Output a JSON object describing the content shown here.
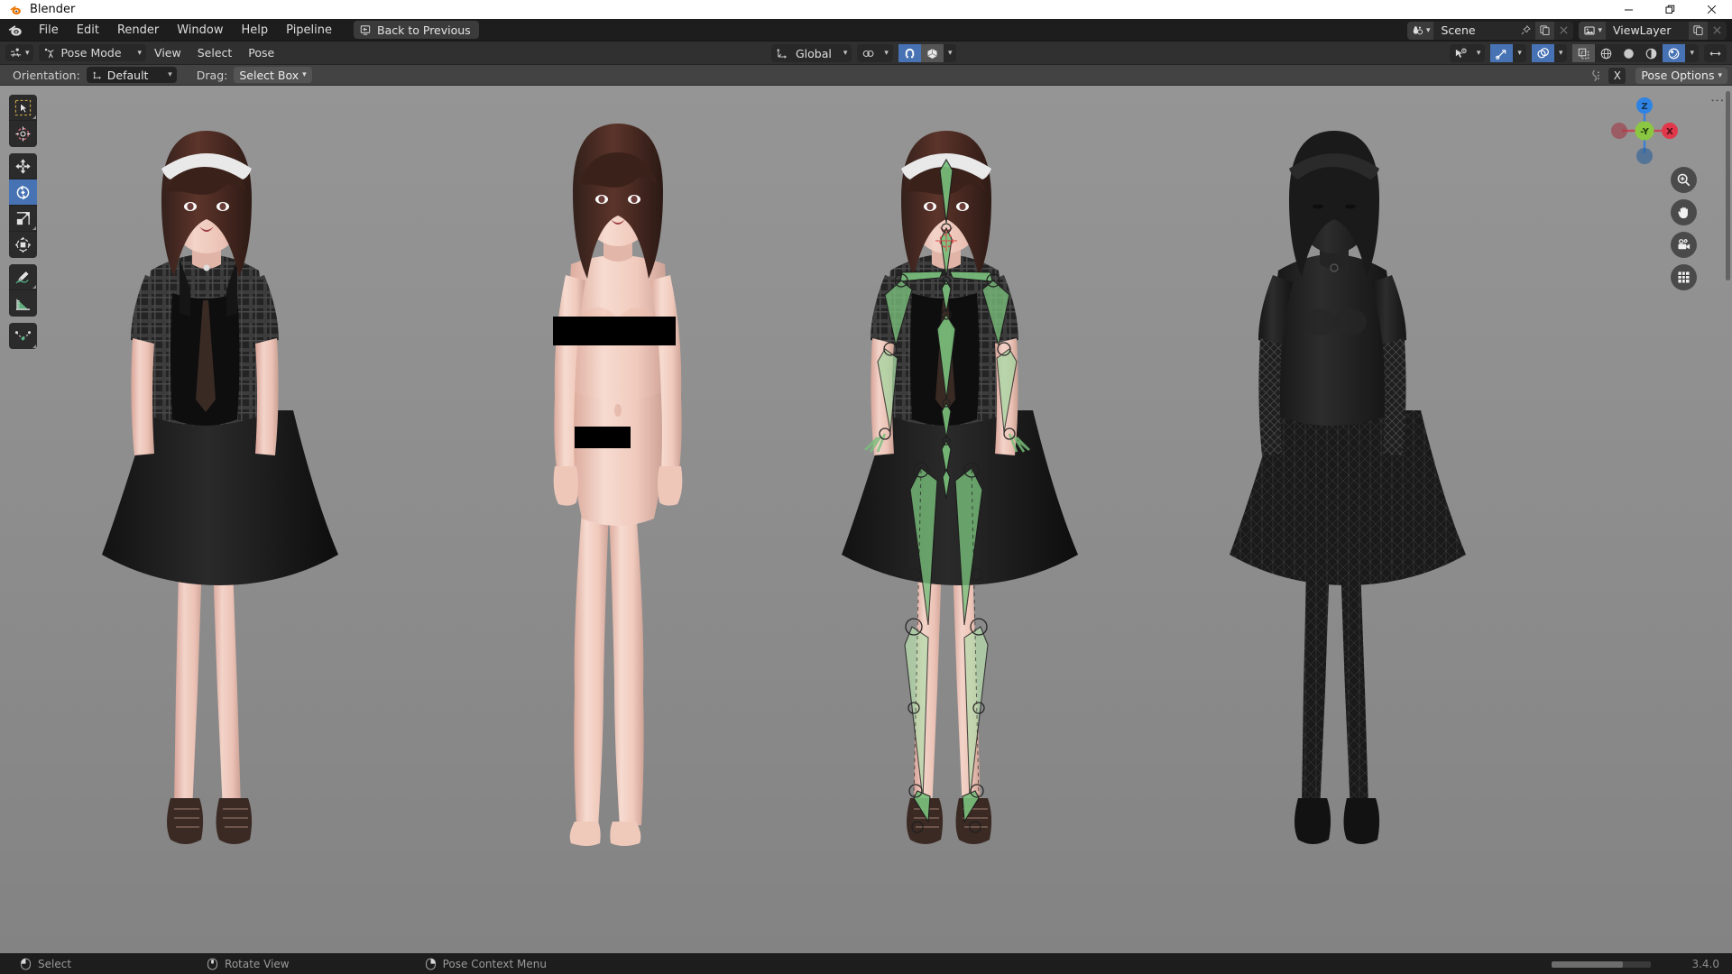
{
  "window": {
    "title": "Blender",
    "controls": {
      "minimize": "—",
      "restore": "❐",
      "close": "✕"
    }
  },
  "topbar": {
    "logo_icon": "blender-logo-icon",
    "menus": [
      {
        "label": "File",
        "name": "menu-file"
      },
      {
        "label": "Edit",
        "name": "menu-edit"
      },
      {
        "label": "Render",
        "name": "menu-render"
      },
      {
        "label": "Window",
        "name": "menu-window"
      },
      {
        "label": "Help",
        "name": "menu-help"
      },
      {
        "label": "Pipeline",
        "name": "menu-pipeline"
      }
    ],
    "back_button": {
      "label": "Back to Previous",
      "icon": "back-to-previous-icon"
    },
    "scene": {
      "icon": "scene-icon",
      "name": "Scene",
      "pin_icon": "pin-icon",
      "new_icon": "new-scene-icon",
      "close_icon": "close-icon"
    },
    "viewlayer": {
      "icon": "viewlayer-icon",
      "name": "ViewLayer",
      "new_icon": "new-viewlayer-icon",
      "close_icon": "close-icon"
    }
  },
  "viewport_header": {
    "editor_type_icon": "editor-type-3dview-icon",
    "mode": {
      "icon": "pose-mode-icon",
      "label": "Pose Mode",
      "chevron": "⌄"
    },
    "menus": [
      {
        "label": "View",
        "name": "viewport-menu-view"
      },
      {
        "label": "Select",
        "name": "viewport-menu-select"
      },
      {
        "label": "Pose",
        "name": "viewport-menu-pose"
      }
    ],
    "transform_orientation": {
      "icon": "orientation-icon",
      "label": "Global"
    },
    "snap": {
      "icon": "snap-icon",
      "enabled": false
    },
    "magnet": {
      "icon": "magnet-icon",
      "enabled": true
    },
    "proportional": {
      "icon": "proportional-editing-icon",
      "enabled": false
    },
    "visibility": {
      "icon": "visibility-icon"
    },
    "gizmo": {
      "icon": "gizmo-icon",
      "enabled": true
    },
    "overlays": {
      "icon": "overlays-icon",
      "enabled": true
    },
    "xray": {
      "icon": "xray-icon",
      "enabled": false
    },
    "shading": [
      {
        "name": "shading-wireframe",
        "icon": "wireframe-icon",
        "active": false
      },
      {
        "name": "shading-solid",
        "icon": "solid-icon",
        "active": false
      },
      {
        "name": "shading-material",
        "icon": "material-preview-icon",
        "active": false
      },
      {
        "name": "shading-rendered",
        "icon": "rendered-icon",
        "active": true
      }
    ],
    "resize_handle_icon": "resize-handle-icon"
  },
  "tool_settings": {
    "orientation_label": "Orientation:",
    "orientation_value": "Default",
    "orientation_icon": "orientation-default-icon",
    "drag_label": "Drag:",
    "drag_value": "Select Box",
    "mirror_icon": "pose-mirror-icon",
    "mirror_axis": "X",
    "pose_options": "Pose Options"
  },
  "toolbar": {
    "tools": [
      {
        "name": "tool-select-box",
        "icon": "select-box-icon",
        "active": false,
        "has_submenu": true
      },
      {
        "name": "tool-cursor",
        "icon": "cursor-icon",
        "active": false,
        "has_submenu": false
      },
      {
        "name": "tool-move",
        "icon": "move-icon",
        "active": false,
        "has_submenu": false
      },
      {
        "name": "tool-rotate",
        "icon": "rotate-icon",
        "active": true,
        "has_submenu": false
      },
      {
        "name": "tool-scale",
        "icon": "scale-icon",
        "active": false,
        "has_submenu": true
      },
      {
        "name": "tool-transform",
        "icon": "transform-icon",
        "active": false,
        "has_submenu": false
      },
      {
        "name": "tool-annotate",
        "icon": "annotate-icon",
        "active": false,
        "has_submenu": true
      },
      {
        "name": "tool-measure",
        "icon": "measure-icon",
        "active": false,
        "has_submenu": false
      },
      {
        "name": "tool-breakdowner",
        "icon": "breakdowner-icon",
        "active": false,
        "has_submenu": true
      }
    ]
  },
  "navigation": {
    "gizmo": {
      "axes": [
        {
          "label": "Z",
          "color": "#2f83e3",
          "name": "gizmo-axis-z"
        },
        {
          "label": "-Y",
          "color": "#8bc742",
          "name": "gizmo-axis-negative-y",
          "active": true
        },
        {
          "label": "X",
          "color": "#e0384a",
          "name": "gizmo-axis-x"
        }
      ]
    },
    "buttons": [
      {
        "name": "nav-zoom-button",
        "icon": "zoom-icon"
      },
      {
        "name": "nav-pan-button",
        "icon": "hand-icon"
      },
      {
        "name": "nav-camera-button",
        "icon": "camera-icon"
      },
      {
        "name": "nav-orthographic-button",
        "icon": "grid-icon"
      }
    ]
  },
  "viewport": {
    "background_color": "#8e8e8e",
    "characters": [
      {
        "name": "character-clothed-shaded",
        "label": "clothed rendered model"
      },
      {
        "name": "character-nude-base-mesh",
        "label": "base body mesh"
      },
      {
        "name": "character-with-armature",
        "label": "clothed model with pose armature"
      },
      {
        "name": "character-wireframe-dark",
        "label": "dark wireframe model"
      }
    ],
    "armature_color": "#79bf7b"
  },
  "statusbar": {
    "items": [
      {
        "icon": "mouse-left-icon",
        "label": "Select",
        "name": "status-select"
      },
      {
        "icon": "mouse-middle-icon",
        "label": "Rotate View",
        "name": "status-rotate-view"
      },
      {
        "icon": "mouse-right-icon",
        "label": "Pose Context Menu",
        "name": "status-pose-context-menu"
      }
    ],
    "version": "3.4.0"
  }
}
